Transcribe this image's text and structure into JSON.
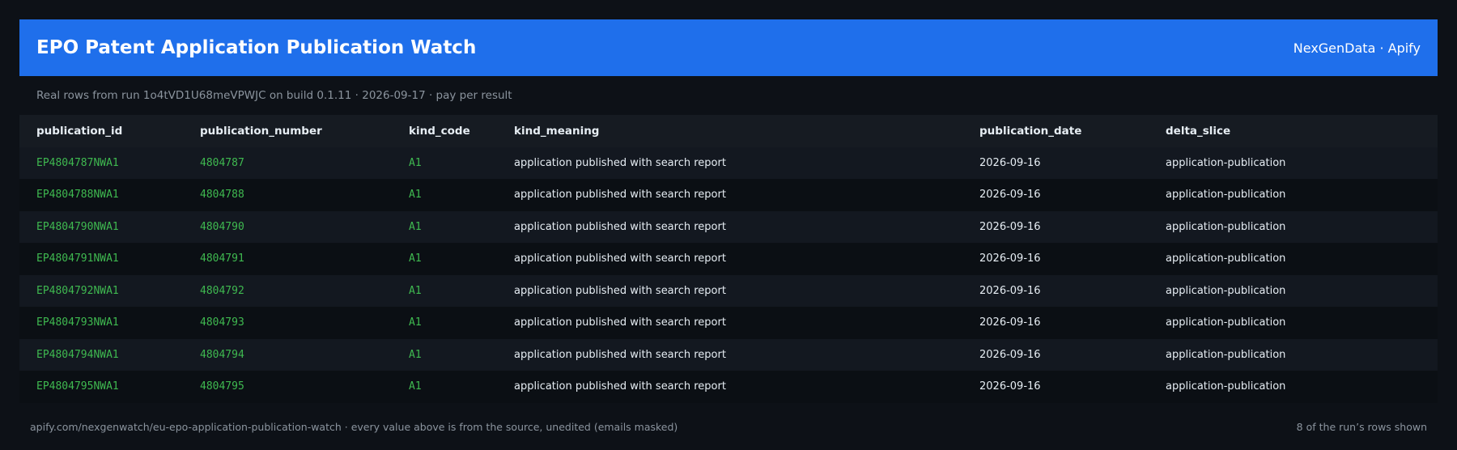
{
  "header": {
    "title": "EPO Patent Application Publication Watch",
    "brand": "NexGenData · Apify"
  },
  "subtitle": "Real rows from run 1o4tVD1U68meVPWJC on build 0.1.11 · 2026-09-17 · pay per result",
  "table": {
    "columns": [
      "publication_id",
      "publication_number",
      "kind_code",
      "kind_meaning",
      "publication_date",
      "delta_slice"
    ],
    "rows": [
      [
        "EP4804787NWA1",
        "4804787",
        "A1",
        "application published with search report",
        "2026-09-16",
        "application-publication"
      ],
      [
        "EP4804788NWA1",
        "4804788",
        "A1",
        "application published with search report",
        "2026-09-16",
        "application-publication"
      ],
      [
        "EP4804790NWA1",
        "4804790",
        "A1",
        "application published with search report",
        "2026-09-16",
        "application-publication"
      ],
      [
        "EP4804791NWA1",
        "4804791",
        "A1",
        "application published with search report",
        "2026-09-16",
        "application-publication"
      ],
      [
        "EP4804792NWA1",
        "4804792",
        "A1",
        "application published with search report",
        "2026-09-16",
        "application-publication"
      ],
      [
        "EP4804793NWA1",
        "4804793",
        "A1",
        "application published with search report",
        "2026-09-16",
        "application-publication"
      ],
      [
        "EP4804794NWA1",
        "4804794",
        "A1",
        "application published with search report",
        "2026-09-16",
        "application-publication"
      ],
      [
        "EP4804795NWA1",
        "4804795",
        "A1",
        "application published with search report",
        "2026-09-16",
        "application-publication"
      ]
    ]
  },
  "footer": {
    "left": "apify.com/nexgenwatch/eu-epo-application-publication-watch  ·  every value above is from the source, unedited (emails masked)",
    "right": "8 of the run’s rows shown"
  },
  "colors": {
    "accent": "#1f6feb",
    "code_green": "#3fb950",
    "background": "#0d1117"
  }
}
